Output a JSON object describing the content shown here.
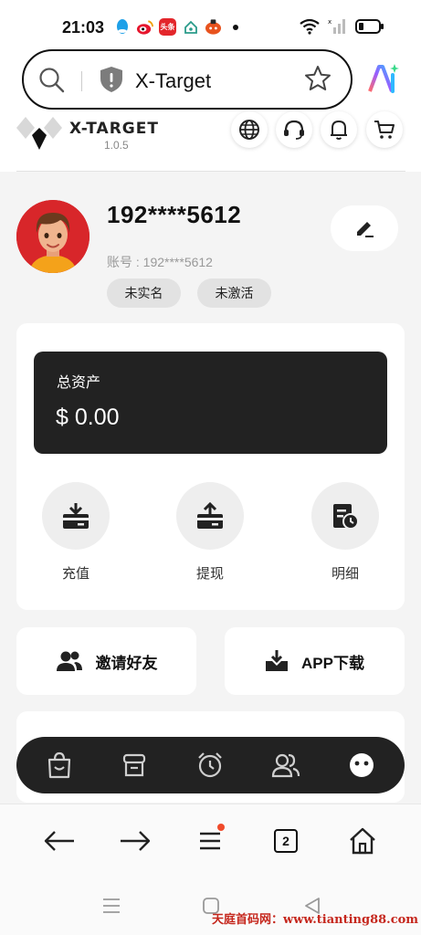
{
  "status_bar": {
    "time": "21:03",
    "notification_icons": [
      "qq-icon",
      "weibo-icon",
      "toutiao-icon",
      "home-app-icon",
      "game-app-icon"
    ],
    "toutiao_text": "头条",
    "battery_level": 0.25
  },
  "browser": {
    "url_text": "X-Target",
    "tab_count": "2"
  },
  "app": {
    "brand": "X-TARGET",
    "version": "1.0.5"
  },
  "profile": {
    "phone": "192****5612",
    "account_label": "账号 : 192****5612",
    "badges": [
      "未实名",
      "未激活"
    ]
  },
  "assets": {
    "label": "总资产",
    "value": "$ 0.00"
  },
  "actions": [
    {
      "label": "充值",
      "icon": "deposit-icon"
    },
    {
      "label": "提现",
      "icon": "withdraw-icon"
    },
    {
      "label": "明细",
      "icon": "details-icon"
    }
  ],
  "quick_links": [
    {
      "label": "邀请好友",
      "icon": "users-icon"
    },
    {
      "label": "APP下载",
      "icon": "download-icon"
    }
  ],
  "bottom_nav": [
    "shopping-bag-icon",
    "store-icon",
    "alarm-icon",
    "team-icon",
    "profile-face-icon"
  ],
  "watermark": "天庭首码网：www.tianting88.com",
  "colors": {
    "card_dark": "#222222",
    "accent_red": "#d8262a",
    "badge_bg": "#e2e2e2"
  }
}
